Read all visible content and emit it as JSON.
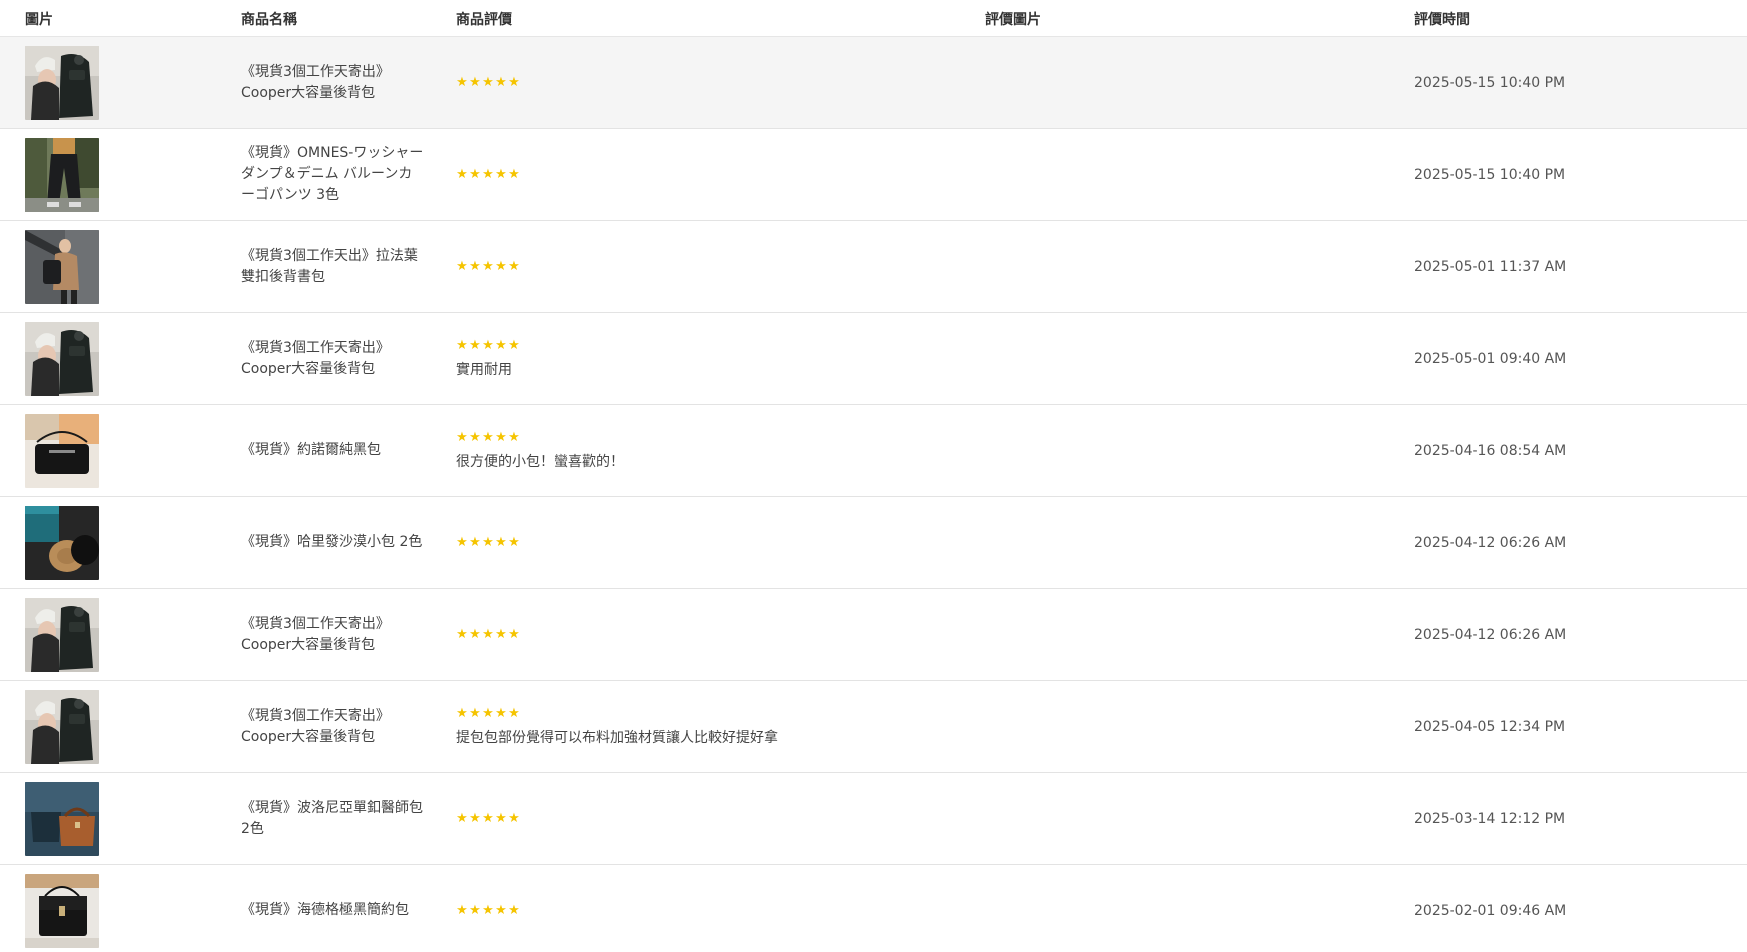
{
  "header": {
    "image": "圖片",
    "name": "商品名稱",
    "rating": "商品評價",
    "photos": "評價圖片",
    "time": "評價時間"
  },
  "colors": {
    "star": "#f5c400",
    "row_highlight": "#f5f5f5",
    "divider": "#e3e3e3"
  },
  "rows": [
    {
      "name": "《現貨3個工作天寄出》Cooper大容量後背包",
      "stars": 5,
      "comment": "",
      "time": "2025-05-15 10:40 PM",
      "thumb": "backpack-black-photo"
    },
    {
      "name": "《現貨》OMNES-ワッシャーダンプ＆デニム バルーンカーゴパンツ 3色",
      "stars": 5,
      "comment": "",
      "time": "2025-05-15 10:40 PM",
      "thumb": "cargo-pants-photo"
    },
    {
      "name": "《現貨3個工作天出》拉法葉雙扣後背書包",
      "stars": 5,
      "comment": "",
      "time": "2025-05-01 11:37 AM",
      "thumb": "school-backpack-photo"
    },
    {
      "name": "《現貨3個工作天寄出》Cooper大容量後背包",
      "stars": 5,
      "comment": "實用耐用",
      "time": "2025-05-01 09:40 AM",
      "thumb": "backpack-black-photo"
    },
    {
      "name": "《現貨》約諾爾純黑包",
      "stars": 5,
      "comment": "很方便的小包！蠻喜歡的！",
      "time": "2025-04-16 08:54 AM",
      "thumb": "black-bag-photo"
    },
    {
      "name": "《現貨》哈里發沙漠小包 2色",
      "stars": 5,
      "comment": "",
      "time": "2025-04-12 06:26 AM",
      "thumb": "desert-bag-photo"
    },
    {
      "name": "《現貨3個工作天寄出》Cooper大容量後背包",
      "stars": 5,
      "comment": "",
      "time": "2025-04-12 06:26 AM",
      "thumb": "backpack-black-photo"
    },
    {
      "name": "《現貨3個工作天寄出》Cooper大容量後背包",
      "stars": 5,
      "comment": "提包包部份覺得可以布料加強材質讓人比較好提好拿",
      "time": "2025-04-05 12:34 PM",
      "thumb": "backpack-black-photo"
    },
    {
      "name": "《現貨》波洛尼亞單釦醫師包 2色",
      "stars": 5,
      "comment": "",
      "time": "2025-03-14 12:12 PM",
      "thumb": "doctor-bag-photo"
    },
    {
      "name": "《現貨》海德格極黑簡約包",
      "stars": 5,
      "comment": "",
      "time": "2025-02-01 09:46 AM",
      "thumb": "minimal-black-bag-photo"
    }
  ]
}
